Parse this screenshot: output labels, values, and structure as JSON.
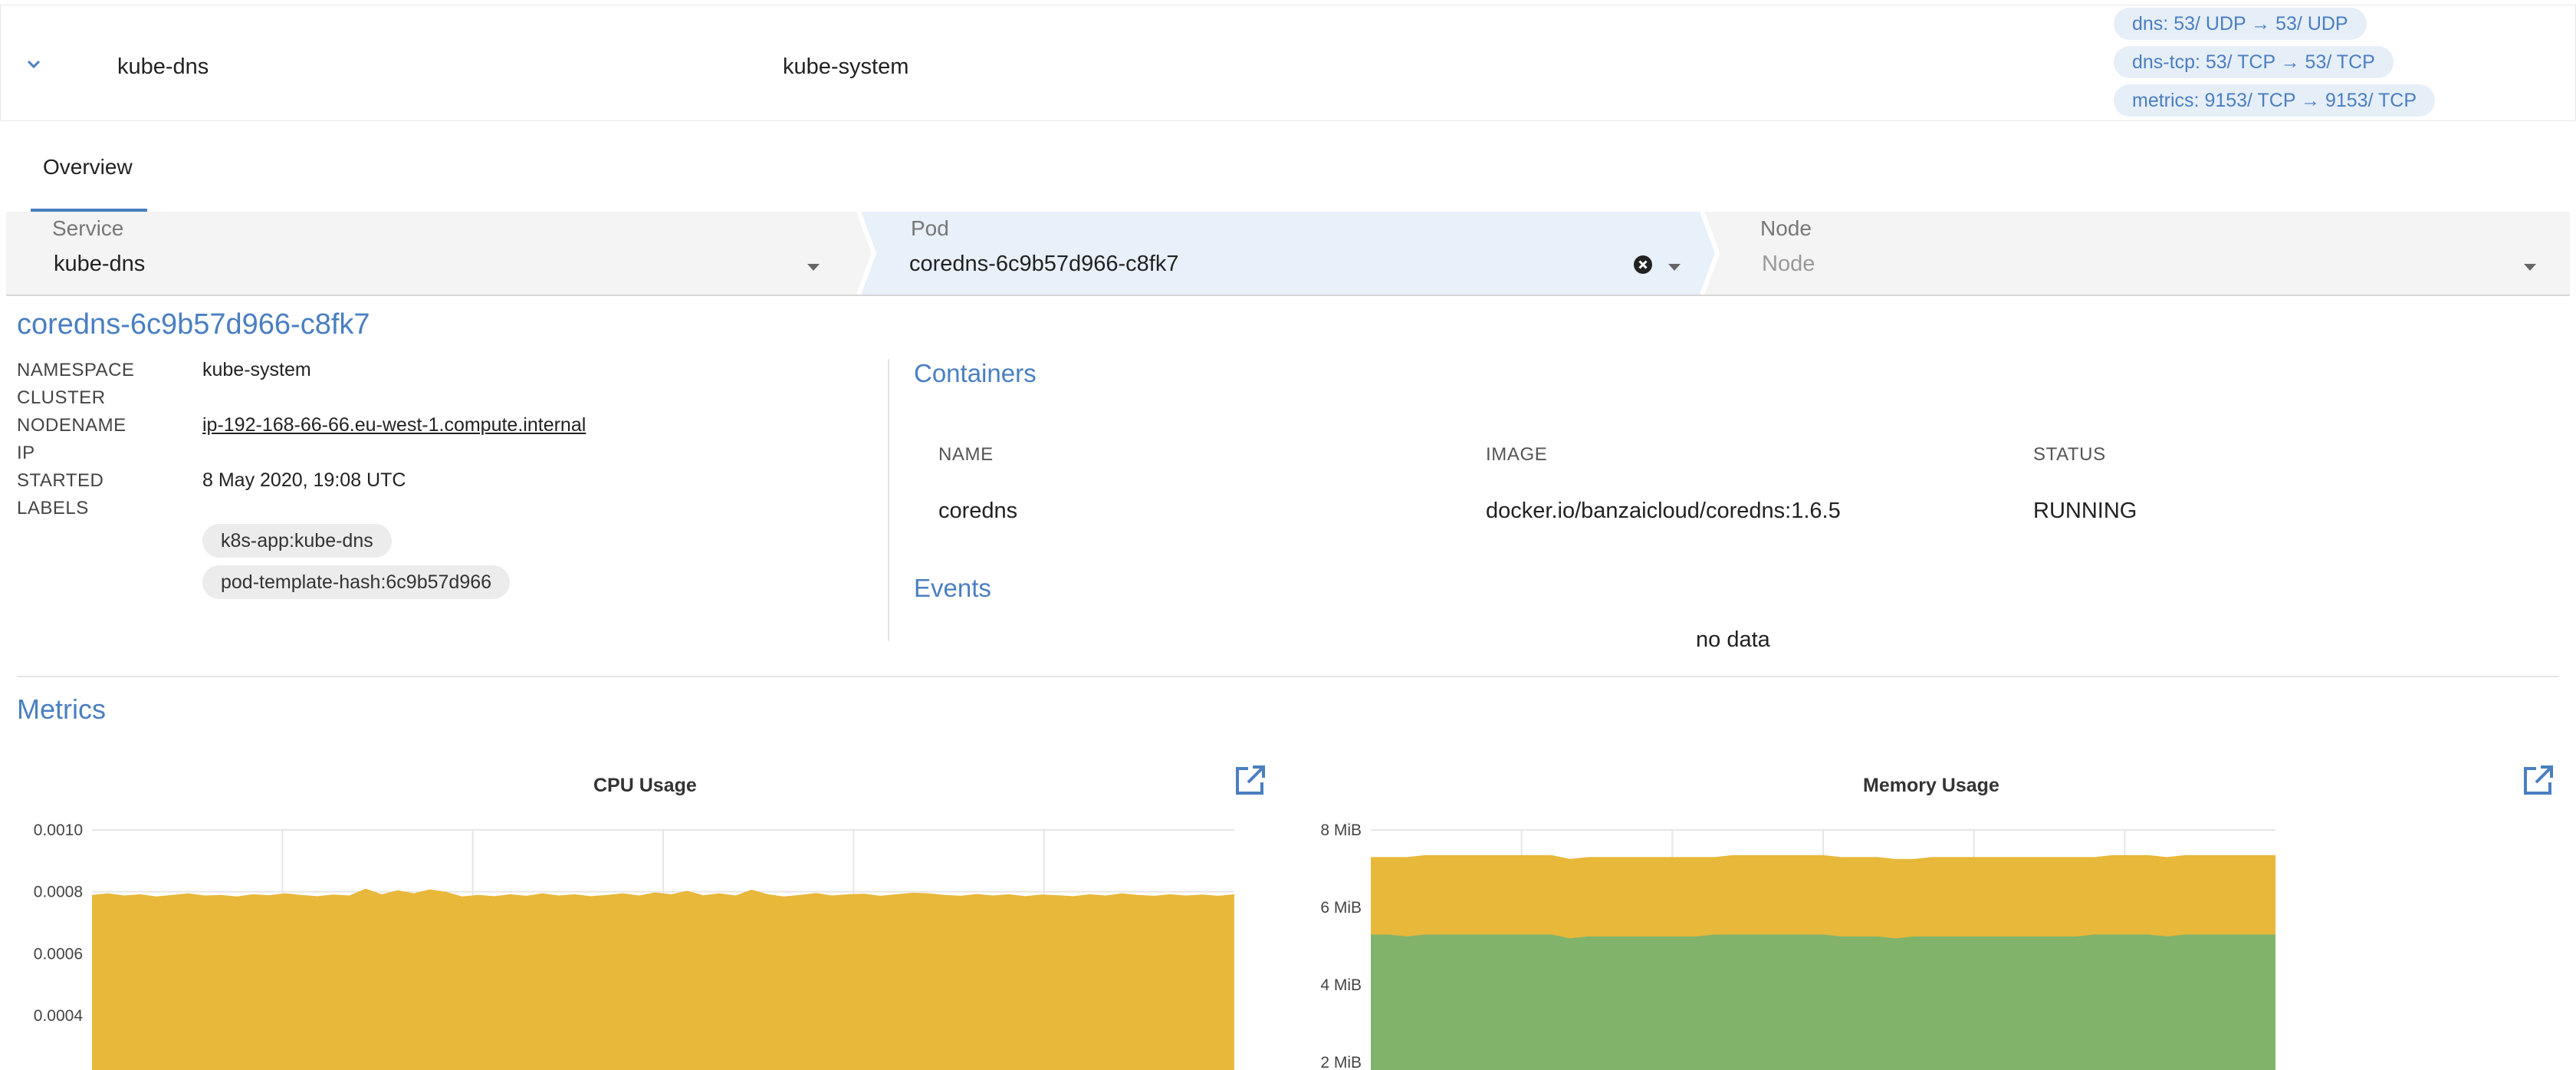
{
  "service_row": {
    "name": "kube-dns",
    "namespace": "kube-system",
    "ports": [
      "dns: 53/ UDP → 53/ UDP",
      "dns-tcp: 53/ TCP → 53/ TCP",
      "metrics: 9153/ TCP → 9153/ TCP"
    ],
    "icon": "chevron-down-icon"
  },
  "tabs": {
    "overview": "Overview"
  },
  "selector": {
    "service": {
      "label": "Service",
      "value": "kube-dns"
    },
    "pod": {
      "label": "Pod",
      "value": "coredns-6c9b57d966-c8fk7"
    },
    "node": {
      "label": "Node",
      "placeholder": "Node"
    }
  },
  "pod": {
    "title": "coredns-6c9b57d966-c8fk7",
    "keys": {
      "namespace": "NAMESPACE",
      "cluster": "CLUSTER",
      "nodename": "NODENAME",
      "ip": "IP",
      "started": "STARTED",
      "labels": "LABELS"
    },
    "namespace": "kube-system",
    "nodename": "ip-192-168-66-66.eu-west-1.compute.internal",
    "started": "8 May 2020, 19:08 UTC",
    "labels": [
      "k8s-app:kube-dns",
      "pod-template-hash:6c9b57d966"
    ]
  },
  "containers": {
    "title": "Containers",
    "headers": {
      "name": "NAME",
      "image": "IMAGE",
      "status": "STATUS"
    },
    "rows": [
      {
        "name": "coredns",
        "image": "docker.io/banzaicloud/coredns:1.6.5",
        "status": "RUNNING"
      }
    ]
  },
  "events": {
    "title": "Events",
    "empty": "no data"
  },
  "metrics": {
    "title": "Metrics"
  },
  "colors": {
    "accent": "#4a7fc1",
    "cpu": "#e8b83a",
    "memory_cache": "#e8b83a",
    "memory_rss": "#82b36b"
  },
  "chart_data": [
    {
      "type": "area",
      "title": "CPU Usage",
      "ytick_labels": [
        "0.0010",
        "0.0008",
        "0.0006",
        "0.0004"
      ],
      "ylim": [
        0.0003,
        0.001
      ],
      "grid": true,
      "series": [
        {
          "values": [
            0.00079,
            0.000795,
            0.000788,
            0.000792,
            0.000785,
            0.00079,
            0.000795,
            0.000788,
            0.00079,
            0.000785,
            0.000792,
            0.000789,
            0.000795,
            0.00079,
            0.000786,
            0.000791,
            0.000788,
            0.00081,
            0.000792,
            0.000805,
            0.000795,
            0.000808,
            0.0008,
            0.000785,
            0.00079,
            0.000786,
            0.000792,
            0.000787,
            0.000795,
            0.000788,
            0.000792,
            0.000786,
            0.00079,
            0.000795,
            0.000788,
            0.000798,
            0.000792,
            0.000803,
            0.000789,
            0.000795,
            0.000788,
            0.000807,
            0.000792,
            0.000785,
            0.00079,
            0.000796,
            0.000788,
            0.000792,
            0.000794,
            0.000787,
            0.000792,
            0.000797,
            0.000795,
            0.00079,
            0.000787,
            0.000793,
            0.000788,
            0.000792,
            0.000786,
            0.000791,
            0.000789,
            0.000786,
            0.000792,
            0.000788,
            0.000795,
            0.00079,
            0.000787,
            0.000792,
            0.000788,
            0.000791,
            0.000787,
            0.000792
          ]
        }
      ]
    },
    {
      "type": "area",
      "title": "Memory Usage",
      "ytick_labels": [
        "8 MiB",
        "6 MiB",
        "4 MiB",
        "2 MiB"
      ],
      "ylim": [
        2,
        8
      ],
      "stacked": true,
      "grid": true,
      "series": [
        {
          "color": "#82b36b",
          "values": [
            5.3,
            5.3,
            5.25,
            5.3,
            5.3,
            5.3,
            5.3,
            5.3,
            5.3,
            5.3,
            5.3,
            5.2,
            5.25,
            5.25,
            5.25,
            5.25,
            5.25,
            5.25,
            5.25,
            5.3,
            5.3,
            5.3,
            5.3,
            5.3,
            5.3,
            5.3,
            5.25,
            5.25,
            5.25,
            5.2,
            5.25,
            5.25,
            5.25,
            5.25,
            5.25,
            5.25,
            5.25,
            5.25,
            5.25,
            5.25,
            5.3,
            5.3,
            5.3,
            5.3,
            5.25,
            5.3,
            5.3,
            5.3,
            5.3,
            5.3,
            5.3
          ]
        },
        {
          "color": "#e8b83a",
          "values": [
            2.0,
            2.0,
            2.05,
            2.05,
            2.05,
            2.05,
            2.05,
            2.05,
            2.05,
            2.05,
            2.05,
            2.05,
            2.05,
            2.05,
            2.05,
            2.05,
            2.05,
            2.05,
            2.05,
            2.0,
            2.05,
            2.05,
            2.05,
            2.05,
            2.05,
            2.05,
            2.05,
            2.05,
            2.05,
            2.05,
            2.0,
            2.05,
            2.05,
            2.05,
            2.05,
            2.05,
            2.05,
            2.05,
            2.05,
            2.05,
            2.0,
            2.05,
            2.05,
            2.05,
            2.05,
            2.05,
            2.05,
            2.05,
            2.05,
            2.05,
            2.05
          ]
        }
      ]
    }
  ]
}
